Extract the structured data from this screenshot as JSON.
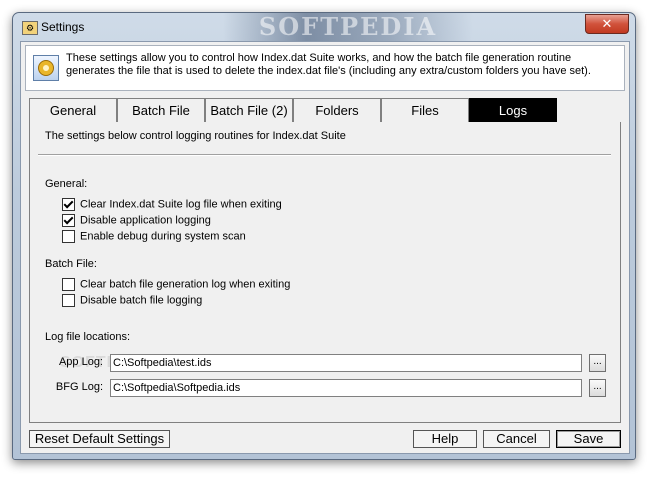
{
  "window": {
    "title": "Settings",
    "watermark": "SOFTPEDIA",
    "close_glyph": "✕"
  },
  "info": {
    "text": "These settings allow you to control how Index.dat Suite works, and how the batch file generation routine generates the file that is used to delete the index.dat file's (including any extra/custom folders you have set).",
    "icon": "settings-gear-icon"
  },
  "tabs": [
    {
      "label": "General",
      "active": false
    },
    {
      "label": "Batch File",
      "active": false
    },
    {
      "label": "Batch File (2)",
      "active": false
    },
    {
      "label": "Folders",
      "active": false
    },
    {
      "label": "Files",
      "active": false
    },
    {
      "label": "Logs",
      "active": true
    }
  ],
  "logs": {
    "heading": "The settings below control logging routines for Index.dat Suite",
    "general_label": "General:",
    "general_options": [
      {
        "label": "Clear Index.dat Suite log file when exiting",
        "checked": true
      },
      {
        "label": "Disable application logging",
        "checked": true
      },
      {
        "label": "Enable debug during system scan",
        "checked": false
      }
    ],
    "batch_label": "Batch File:",
    "batch_options": [
      {
        "label": "Clear batch file generation log when exiting",
        "checked": false
      },
      {
        "label": "Disable batch file logging",
        "checked": false
      }
    ],
    "locations_label": "Log file locations:",
    "app_log": {
      "label": "App Log:",
      "value": "C:\\Softpedia\\test.ids"
    },
    "bfg_log": {
      "label": "BFG Log:",
      "value": "C:\\Softpedia\\Softpedia.ids"
    },
    "browse_label": "..."
  },
  "buttons": {
    "reset": "Reset Default Settings",
    "help": "Help",
    "cancel": "Cancel",
    "save": "Save"
  },
  "center_watermark": "SOFTPEDIA"
}
